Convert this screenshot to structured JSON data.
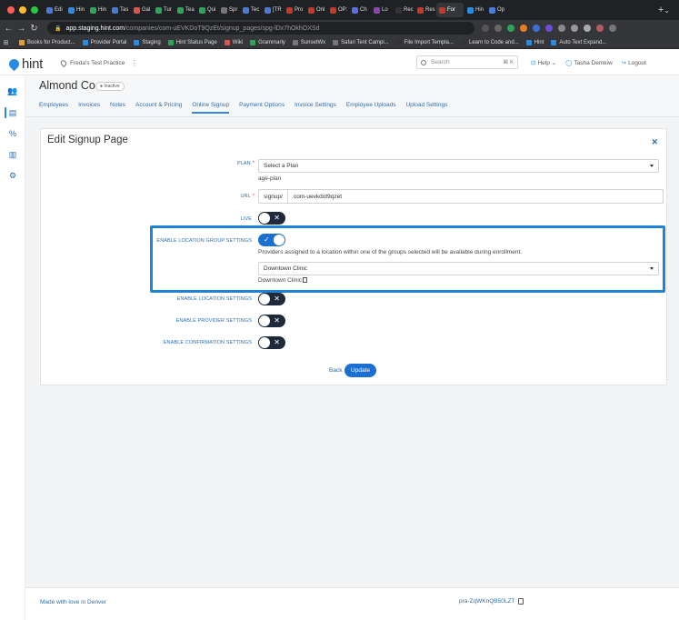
{
  "browser": {
    "tabs": [
      "Edi",
      "Hin",
      "Hin",
      "Tas",
      "Gal",
      "Tur",
      "Tea",
      "Qui",
      "Spr",
      "Tec",
      "[TR",
      "Pro",
      "Onl",
      "OP:",
      "Ch",
      "Lo",
      "Rec",
      "Res",
      "For",
      "Hin",
      "Op"
    ],
    "active_tab_index": 18,
    "tab_colors": [
      "#4a7bd6",
      "#2a8ce0",
      "#2fa35a",
      "#4a7bd6",
      "#d9534f",
      "#2fa35a",
      "#2fa35a",
      "#2fa35a",
      "#777",
      "#4a7bd6",
      "#4a7bd6",
      "#c0392b",
      "#c0392b",
      "#c0392b",
      "#5b6ee1",
      "#8e44ad",
      "#333",
      "#c0392b",
      "#c0392b",
      "#2a8ce0",
      "#4a7bd6"
    ],
    "url_host": "app.staging.hint.com",
    "url_path": "/companies/com-uEVKDoT9QzEt/signup_pages/spg-lDx7hOkhOXSd",
    "bookmarks": [
      "Books for Product...",
      "Provider Portal",
      "Staging",
      "Hint Status Page",
      "Wiki",
      "Grammarly",
      "SunsetWx",
      "Safari Tent Campi...",
      "File Import Templa...",
      "Learn to Code and...",
      "Hint",
      "Auto Text Expand..."
    ]
  },
  "header": {
    "logo": "hint",
    "practice": "Freda's Test Practice",
    "search_placeholder": "Search",
    "search_shortcut": "⌘ K",
    "help": "Help",
    "user": "Tasha Demkiw",
    "logout": "Logout"
  },
  "company": {
    "name": "Almond Co",
    "status": "Inactive",
    "tabs": [
      "Employees",
      "Invoices",
      "Notes",
      "Account & Pricing",
      "Online Signup",
      "Payment Options",
      "Invoice Settings",
      "Employee Uploads",
      "Upload Settings"
    ],
    "active_tab": "Online Signup"
  },
  "form": {
    "title": "Edit Signup Page",
    "plan_label": "PLAN",
    "plan_value": "Select a Plan",
    "plan_help": "age-plan",
    "url_label": "URL",
    "url_prefix": "signup/",
    "url_value": "com-uevkdot9qzet",
    "live_label": "LIVE",
    "live_on": false,
    "location_group_label": "ENABLE LOCATION GROUP SETTINGS",
    "location_group_on": true,
    "location_group_help": "Providers assigned to a location within one of the groups selected will be available during enrollment.",
    "location_group_select": "Downtown Clinic",
    "location_group_selected_note": "Downtown Clinic",
    "location_label": "ENABLE LOCATION SETTINGS",
    "location_on": false,
    "provider_label": "ENABLE PROVIDER SETTINGS",
    "provider_on": false,
    "confirmation_label": "ENABLE CONFIRMATION SETTINGS",
    "confirmation_on": false,
    "back": "Back",
    "update": "Update"
  },
  "footer": {
    "text": "Made with love in Denver",
    "id": "pra-ZqWKnQB50LZT"
  },
  "colors": {
    "accent": "#1a6fd1",
    "highlight": "#1f82d4",
    "toggle_off": "#1f2a3a"
  }
}
